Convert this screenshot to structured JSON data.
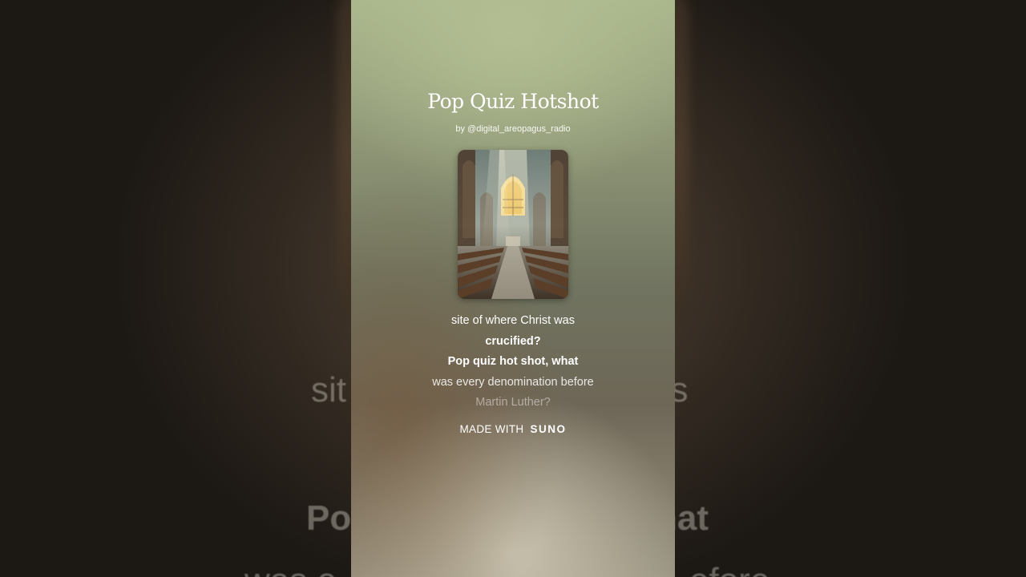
{
  "song": {
    "title": "Pop Quiz Hotshot",
    "author": "by @digital_areopagus_radio"
  },
  "cover_art": {
    "icon": "cathedral-cover-image"
  },
  "lyrics": {
    "lines": [
      {
        "text": "site of where Christ was",
        "style": "normal"
      },
      {
        "text": "crucified?",
        "style": "bold"
      },
      {
        "text": "Pop quiz hot shot, what",
        "style": "bold"
      },
      {
        "text": "was every denomination before",
        "style": "dim1"
      },
      {
        "text": "Martin Luther?",
        "style": "dim2"
      }
    ]
  },
  "background_lyrics": {
    "line1_left": "sit",
    "line1_right": "as",
    "line2_left": "Po",
    "line2_right": "hat",
    "line3_left": "was e",
    "line3_right": "efore"
  },
  "footer": {
    "made_with_label": "MADE WITH",
    "brand": "SUNO"
  },
  "colors": {
    "card_top": "#a9b58c",
    "card_bottom": "#9a9482",
    "background": "#1a1612",
    "text": "#ffffff"
  }
}
